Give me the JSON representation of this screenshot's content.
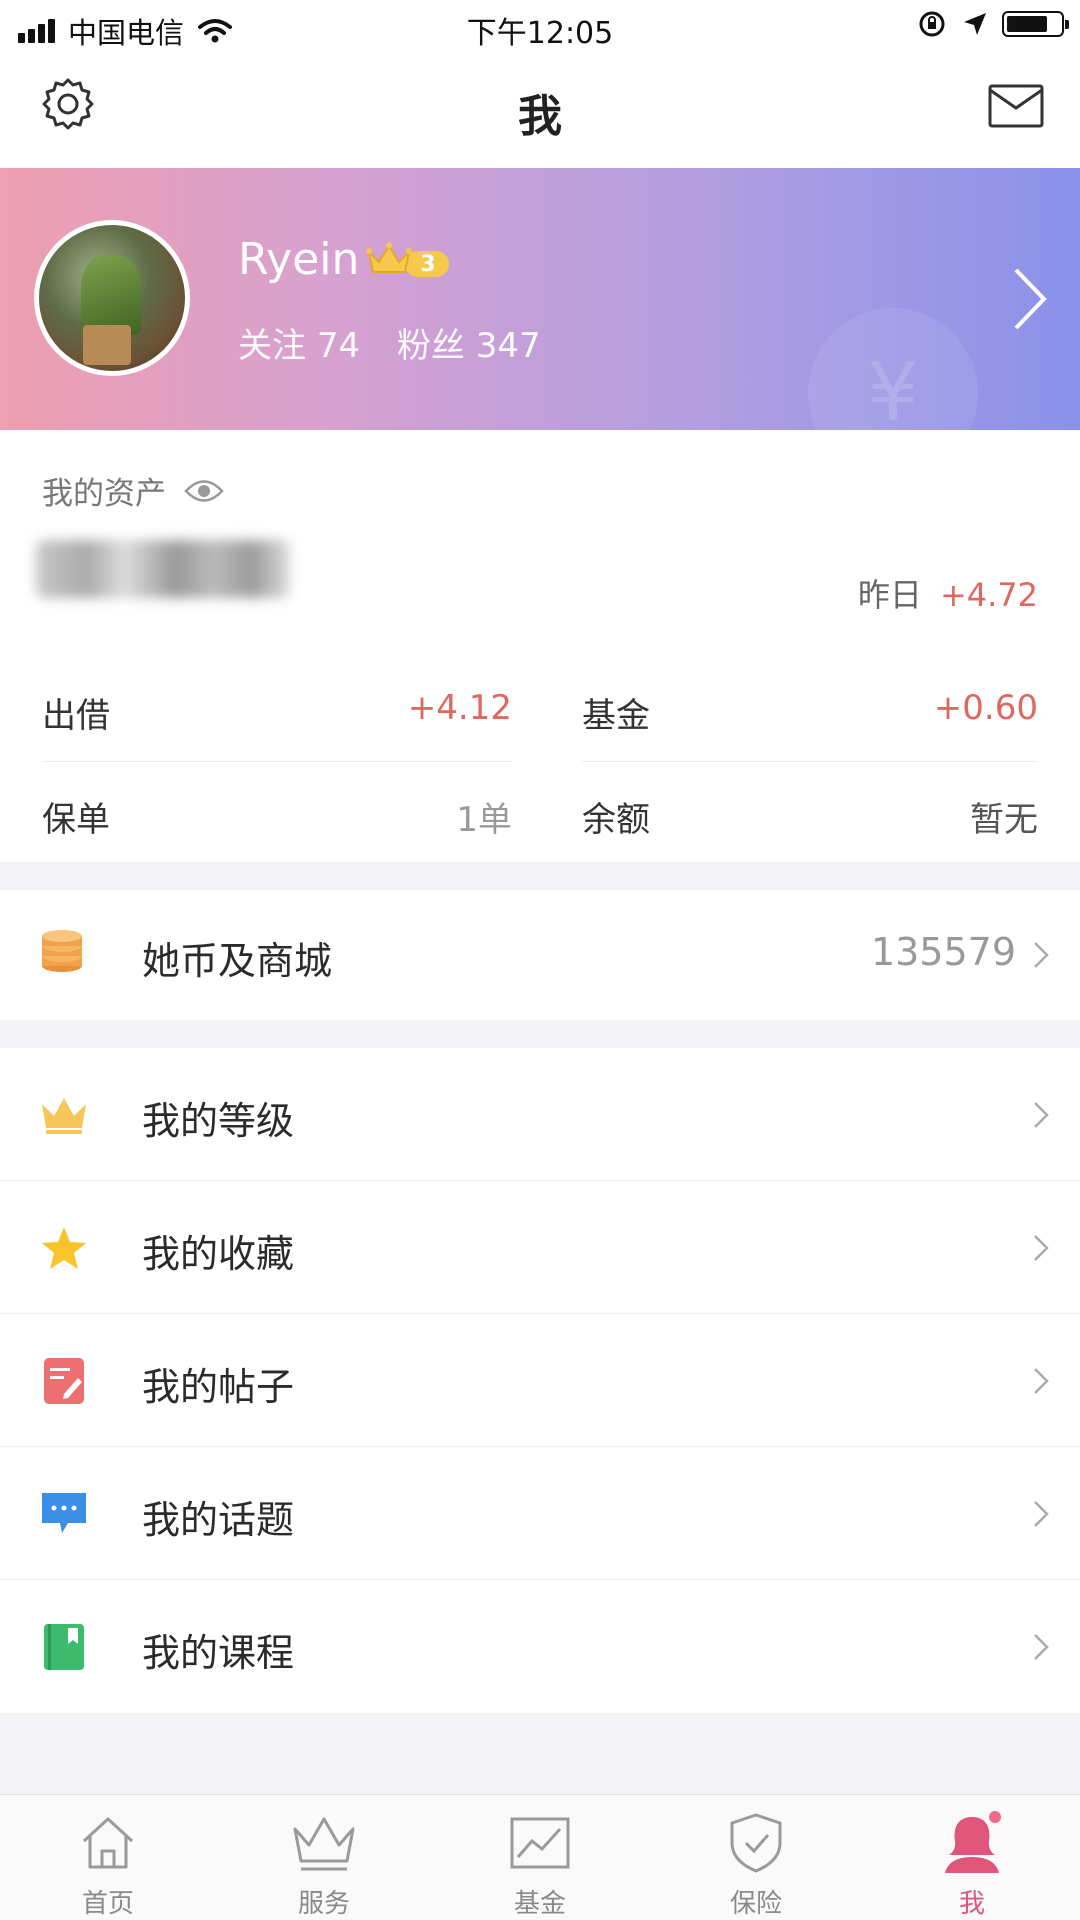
{
  "status_bar": {
    "carrier": "中国电信",
    "time": "下午12:05",
    "icons": [
      "signal-icon",
      "wifi-icon",
      "orientation-lock-icon",
      "location-icon",
      "battery-icon"
    ]
  },
  "nav": {
    "title": "我",
    "left_icon": "gear-icon",
    "right_icon": "mail-icon"
  },
  "profile": {
    "username": "Ryein",
    "level": "3",
    "follow_label": "关注",
    "follow_count": "74",
    "fans_label": "粉丝",
    "fans_count": "347",
    "colors": {
      "gradient_start": "#ee9fb0",
      "gradient_end": "#8a92ea"
    }
  },
  "assets": {
    "title": "我的资产",
    "yesterday_label": "昨日",
    "yesterday_value": "+4.72",
    "cells": [
      {
        "label": "出借",
        "value": "+4.12"
      },
      {
        "label": "基金",
        "value": "+0.60"
      },
      {
        "label": "保单",
        "value": "1单"
      },
      {
        "label": "余额",
        "value": "暂无"
      }
    ]
  },
  "coins": {
    "label": "她币及商城",
    "value": "135579",
    "icon": "coin-stack-icon"
  },
  "menu": [
    {
      "label": "我的等级",
      "icon": "crown-icon"
    },
    {
      "label": "我的收藏",
      "icon": "star-icon"
    },
    {
      "label": "我的帖子",
      "icon": "post-icon"
    },
    {
      "label": "我的话题",
      "icon": "chat-icon"
    },
    {
      "label": "我的课程",
      "icon": "course-book-icon"
    }
  ],
  "tabs": [
    {
      "label": "首页",
      "icon": "home-icon"
    },
    {
      "label": "服务",
      "icon": "crown-outline-icon"
    },
    {
      "label": "基金",
      "icon": "chart-icon"
    },
    {
      "label": "保险",
      "icon": "shield-icon"
    },
    {
      "label": "我",
      "icon": "person-icon"
    }
  ],
  "accent_colors": {
    "red_value": "#e0675f",
    "tab_active": "#e0567a",
    "coin_orange": "#f0a24d"
  }
}
